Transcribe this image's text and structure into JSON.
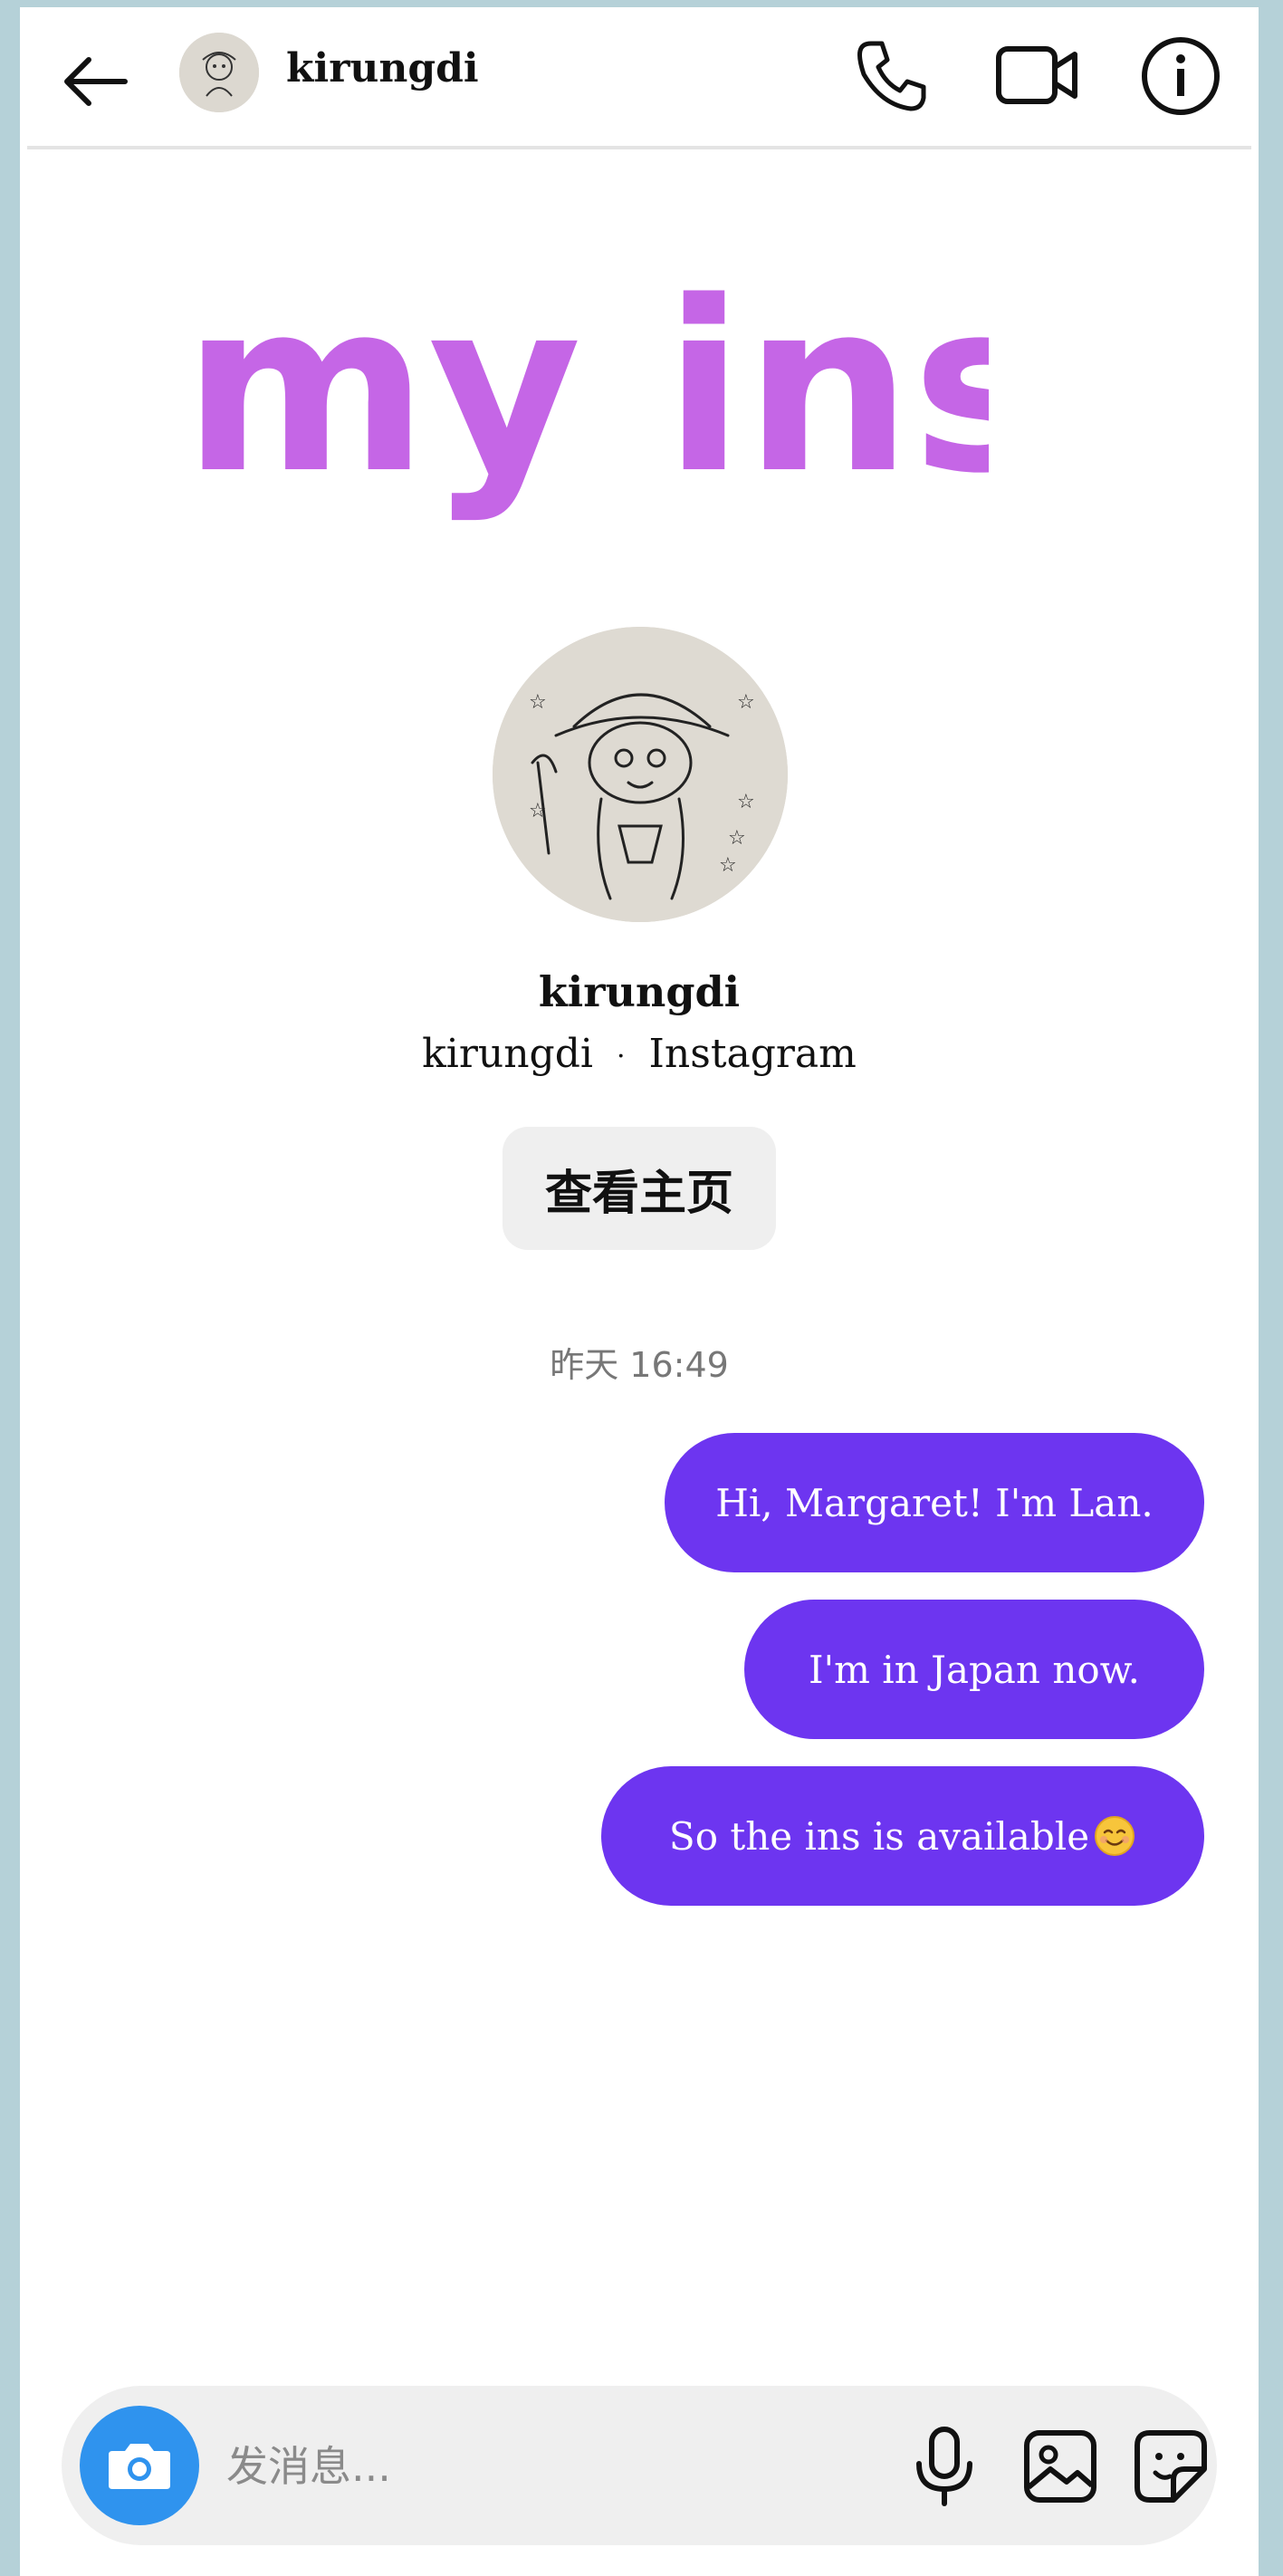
{
  "header": {
    "username": "kirungdi",
    "icons": [
      "back-arrow-icon",
      "phone-icon",
      "video-camera-icon",
      "info-icon"
    ]
  },
  "sticker": {
    "text": "my ins",
    "color": "#c566e6"
  },
  "profile": {
    "name": "kirungdi",
    "handle": "kirungdi",
    "separator": "·",
    "platform": "Instagram",
    "view_profile_label": "查看主页"
  },
  "conversation": {
    "timestamp": "昨天 16:49",
    "messages": [
      {
        "text": "Hi, Margaret! I'm Lan."
      },
      {
        "text": "I'm in Japan now."
      },
      {
        "text": "So the ins is available",
        "emoji": "smiling-face-icon"
      }
    ],
    "bubble_color": "#6d35f0"
  },
  "composer": {
    "placeholder": "发消息...",
    "icons": [
      "camera-icon",
      "microphone-icon",
      "gallery-icon",
      "sticker-icon"
    ],
    "camera_color": "#2f93ee"
  }
}
